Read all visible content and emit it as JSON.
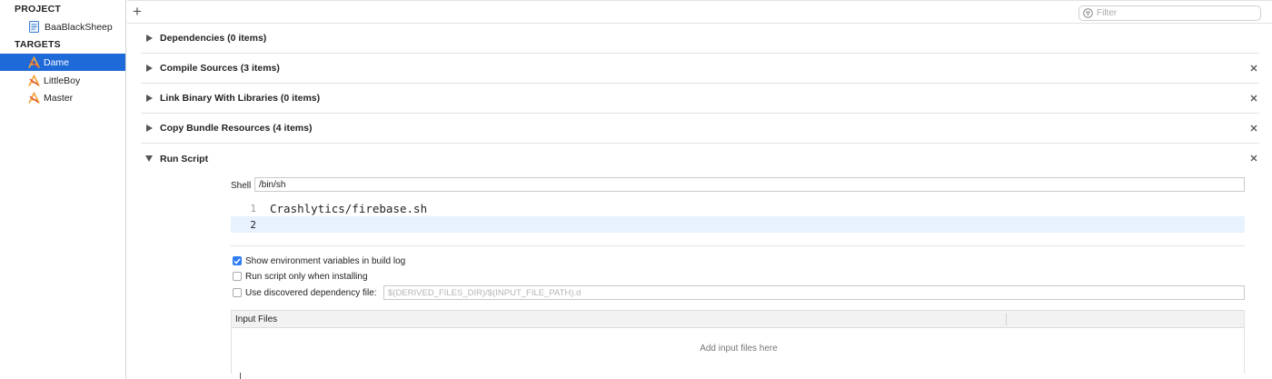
{
  "sidebar": {
    "project_header": "PROJECT",
    "project_item": "BaaBlackSheep",
    "targets_header": "TARGETS",
    "targets": [
      {
        "label": "Dame",
        "selected": true
      },
      {
        "label": "LittleBoy",
        "selected": false
      },
      {
        "label": "Master",
        "selected": false
      }
    ]
  },
  "toolbar": {
    "add_label": "+",
    "filter_placeholder": "Filter"
  },
  "phases": [
    {
      "title": "Dependencies (0 items)",
      "expanded": false,
      "closable": false
    },
    {
      "title": "Compile Sources (3 items)",
      "expanded": false,
      "closable": true
    },
    {
      "title": "Link Binary With Libraries (0 items)",
      "expanded": false,
      "closable": true
    },
    {
      "title": "Copy Bundle Resources (4 items)",
      "expanded": false,
      "closable": true
    },
    {
      "title": "Run Script",
      "expanded": true,
      "closable": true
    }
  ],
  "run_script": {
    "shell_label": "Shell",
    "shell_value": "/bin/sh",
    "lines": [
      {
        "number": "1",
        "code": "Crashlytics/firebase.sh"
      },
      {
        "number": "2",
        "code": ""
      }
    ],
    "options": [
      {
        "label": "Show environment variables in build log",
        "checked": true
      },
      {
        "label": "Run script only when installing",
        "checked": false
      },
      {
        "label": "Use discovered dependency file:",
        "checked": false
      }
    ],
    "dependency_placeholder": "$(DERIVED_FILES_DIR)/$(INPUT_FILE_PATH).d",
    "input_files_header": "Input Files",
    "input_files_empty": "Add input files here"
  },
  "colors": {
    "selection": "#1f6ad9",
    "checkbox_checked": "#2f7cf6",
    "current_line": "#e8f2fe"
  }
}
